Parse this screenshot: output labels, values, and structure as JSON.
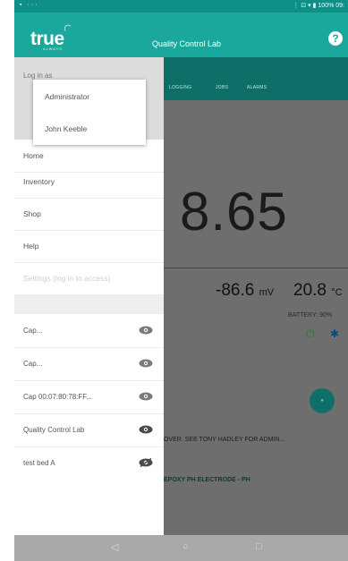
{
  "status_bar": {
    "left_icons": "▪ ···",
    "right_text": "⋮ ⊡ ▾ ▮ 100% 09:"
  },
  "app_bar": {
    "logo_text": "true",
    "logo_sub": "ALWAYS",
    "title": "Quality Control Lab",
    "help_label": "?"
  },
  "background": {
    "tabs": [
      "LOGGING",
      "JOBS",
      "ALARMS"
    ],
    "reading": "8.65",
    "mv_value": "-86.6",
    "mv_unit": "mV",
    "temp_value": "20.8",
    "temp_unit": "°C",
    "battery": "BATTERY: 90%",
    "info_line_1": "OVER. SEE TONY HADLEY FOR ADMIN...",
    "info_line_2": "EPOXY PH ELECTRODE - PH"
  },
  "drawer": {
    "login_label": "Log in as",
    "nav_items": [
      {
        "label": "Home"
      },
      {
        "label": "Inventory"
      },
      {
        "label": "Shop"
      },
      {
        "label": "Help"
      },
      {
        "label": "Settings (log in to access)"
      }
    ],
    "devices": [
      {
        "label": "Cap...",
        "icon": "eye-icon"
      },
      {
        "label": "Cap...",
        "icon": "eye-icon"
      },
      {
        "label": "Cap 00:07:80:78:FF...",
        "icon": "eye-icon"
      },
      {
        "label": "Quality Control Lab",
        "icon": "eye-icon"
      },
      {
        "label": "test bed A",
        "icon": "eye-off-icon"
      }
    ]
  },
  "login_popup": {
    "options": [
      "Administrator",
      "John Keeble"
    ]
  },
  "colors": {
    "accent": "#1aa89c",
    "accent_dark": "#0d6f68",
    "status_bar": "#0f8f86"
  }
}
